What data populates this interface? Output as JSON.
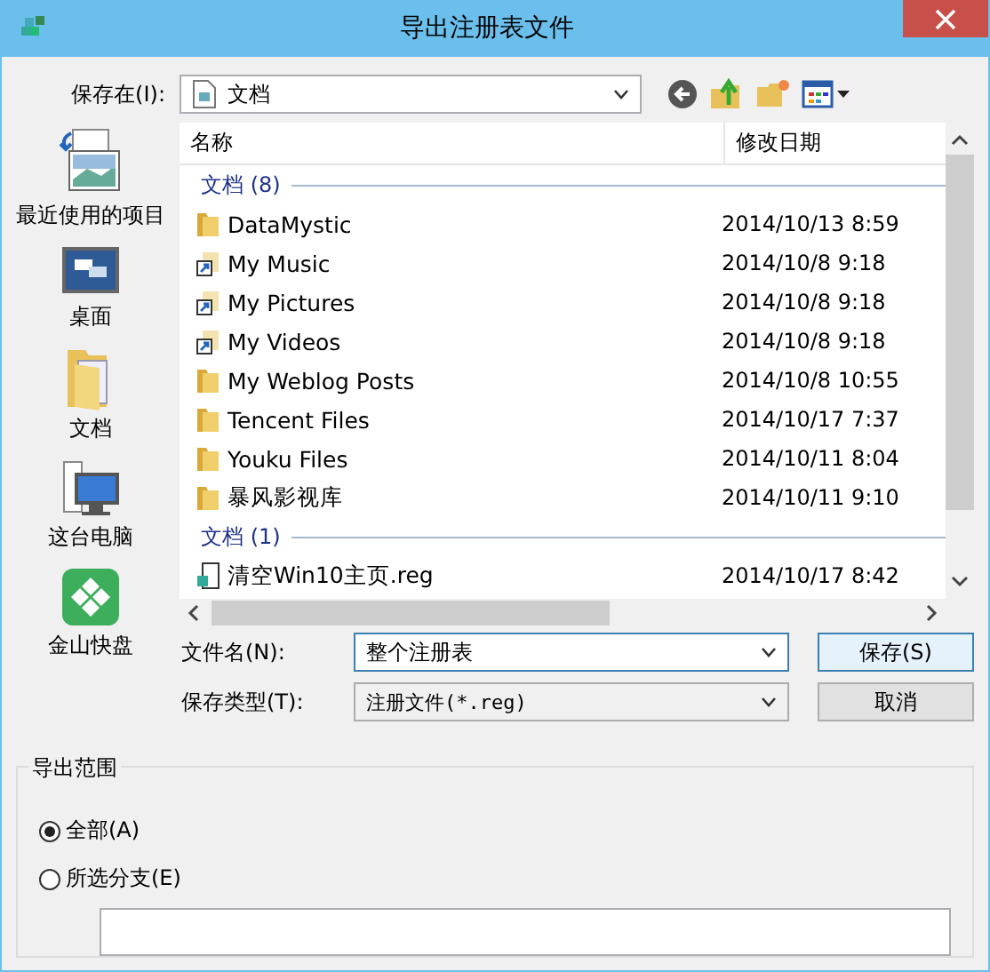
{
  "window": {
    "title": "导出注册表文件"
  },
  "save_in": {
    "label": "保存在(I):",
    "value": "文档"
  },
  "places": [
    {
      "label": "最近使用的项目",
      "kind": "recent"
    },
    {
      "label": "桌面",
      "kind": "desktop"
    },
    {
      "label": "文档",
      "kind": "documents"
    },
    {
      "label": "这台电脑",
      "kind": "computer"
    },
    {
      "label": "金山快盘",
      "kind": "kuaipan"
    }
  ],
  "columns": [
    "名称",
    "修改日期"
  ],
  "groups": [
    {
      "header": "文档 (8)",
      "items": [
        {
          "name": "DataMystic",
          "date": "2014/10/13 8:59",
          "kind": "folder"
        },
        {
          "name": "My Music",
          "date": "2014/10/8 9:18",
          "kind": "shortcut"
        },
        {
          "name": "My Pictures",
          "date": "2014/10/8 9:18",
          "kind": "shortcut"
        },
        {
          "name": "My Videos",
          "date": "2014/10/8 9:18",
          "kind": "shortcut"
        },
        {
          "name": "My Weblog Posts",
          "date": "2014/10/8 10:55",
          "kind": "folder"
        },
        {
          "name": "Tencent Files",
          "date": "2014/10/17 7:37",
          "kind": "folder"
        },
        {
          "name": "Youku Files",
          "date": "2014/10/11 8:04",
          "kind": "folder"
        },
        {
          "name": "暴风影视库",
          "date": "2014/10/11 9:10",
          "kind": "folder"
        }
      ]
    },
    {
      "header": "文档 (1)",
      "items": [
        {
          "name": "清空Win10主页.reg",
          "date": "2014/10/17 8:42",
          "kind": "reg"
        }
      ]
    }
  ],
  "file_name": {
    "label": "文件名(N):",
    "value": "整个注册表"
  },
  "file_type": {
    "label": "保存类型(T):",
    "value": "注册文件(*.reg)"
  },
  "buttons": [
    "保存(S)",
    "取消"
  ],
  "export_range": {
    "title": "导出范围",
    "options": [
      {
        "label": "全部(A)",
        "selected": true
      },
      {
        "label": "所选分支(E)",
        "selected": false
      }
    ]
  }
}
